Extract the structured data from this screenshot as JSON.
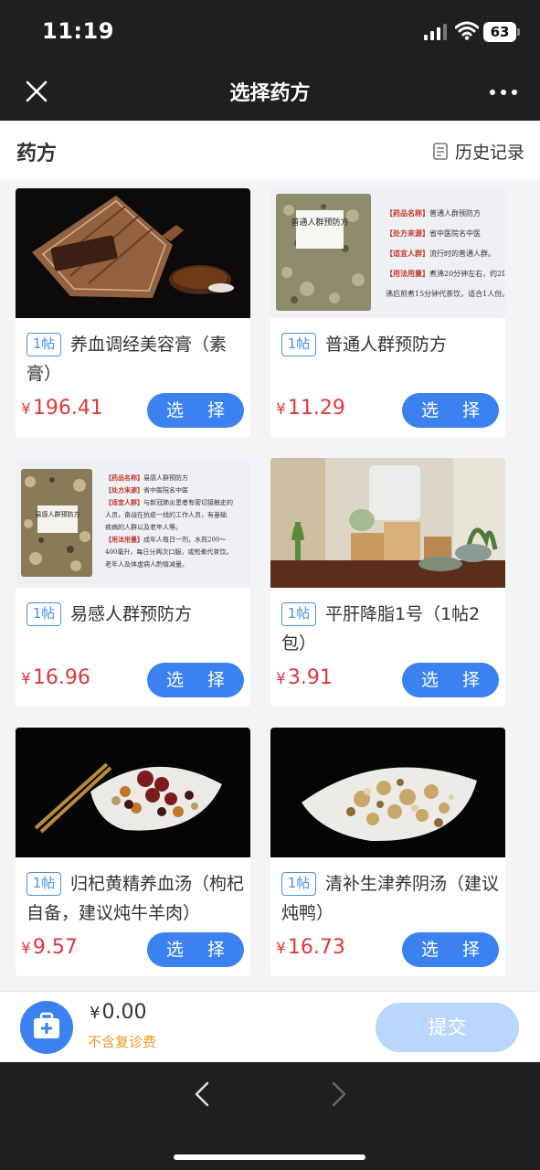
{
  "status_bar": {
    "time": "11:19",
    "battery": "63"
  },
  "nav": {
    "title": "选择药方"
  },
  "section": {
    "title": "药方",
    "history_label": "历史记录"
  },
  "products": [
    {
      "tag": "1帖",
      "name": "养血调经美容膏（素膏）",
      "price": "196.41",
      "button": "选 择",
      "image": "tea-paste-fan"
    },
    {
      "tag": "1帖",
      "name": "普通人群预防方",
      "price": "11.29",
      "button": "选 择",
      "image": "herb-bag-label",
      "image_text": {
        "bag_label": "普通人群预防方",
        "lines": [
          [
            "【药品名称】",
            "普通人群预防方"
          ],
          [
            "【处方来源】",
            "省中医院名中医"
          ],
          [
            "【适宜人群】",
            "流行时的普通人群。"
          ],
          [
            "【用法用量】",
            "煮沸20分钟左右，约2L锅"
          ],
          [
            "",
            "沸后煎煮15分钟代茶饮，适合1人份。"
          ]
        ]
      }
    },
    {
      "tag": "1帖",
      "name": "易感人群预防方",
      "price": "16.96",
      "button": "选 择",
      "image": "herb-bag-label",
      "image_text": {
        "bag_label": "易感人群预防方",
        "lines": [
          [
            "【药品名称】",
            "易感人群预防方"
          ],
          [
            "【处方来源】",
            "省中医院名中医"
          ],
          [
            "【适宜人群】",
            "与新冠肺炎患者有密切接触史的"
          ],
          [
            "",
            "人员，奋战在抗疫一线的工作人员，有基础"
          ],
          [
            "",
            "疾病的人群以及老年人等。"
          ],
          [
            "【用法用量】",
            "成年人每日一剂，水煎200～"
          ],
          [
            "",
            "400毫升，每日分两次口服，或煎煮代茶饮。"
          ],
          [
            "",
            "老年人及体虚病人酌情减量。"
          ]
        ]
      }
    },
    {
      "tag": "1帖",
      "name": "平肝降脂1号（1帖2包）",
      "price": "3.91",
      "button": "选 择",
      "image": "tea-table"
    },
    {
      "tag": "1帖",
      "name": "归杞黄精养血汤（枸杞自备，建议炖牛羊肉）",
      "price": "9.57",
      "button": "选 择",
      "image": "leaf-plate-red"
    },
    {
      "tag": "1帖",
      "name": "清补生津养阴汤（建议炖鸭）",
      "price": "16.73",
      "button": "选 择",
      "image": "leaf-plate-herbs"
    }
  ],
  "footer": {
    "total": "0.00",
    "currency": "¥",
    "fee_note": "不含复诊费",
    "submit_label": "提交"
  },
  "colors": {
    "accent": "#3b82f0",
    "price": "#e0373a",
    "note": "#e79a1b",
    "submit_disabled": "#b9d6fb"
  }
}
